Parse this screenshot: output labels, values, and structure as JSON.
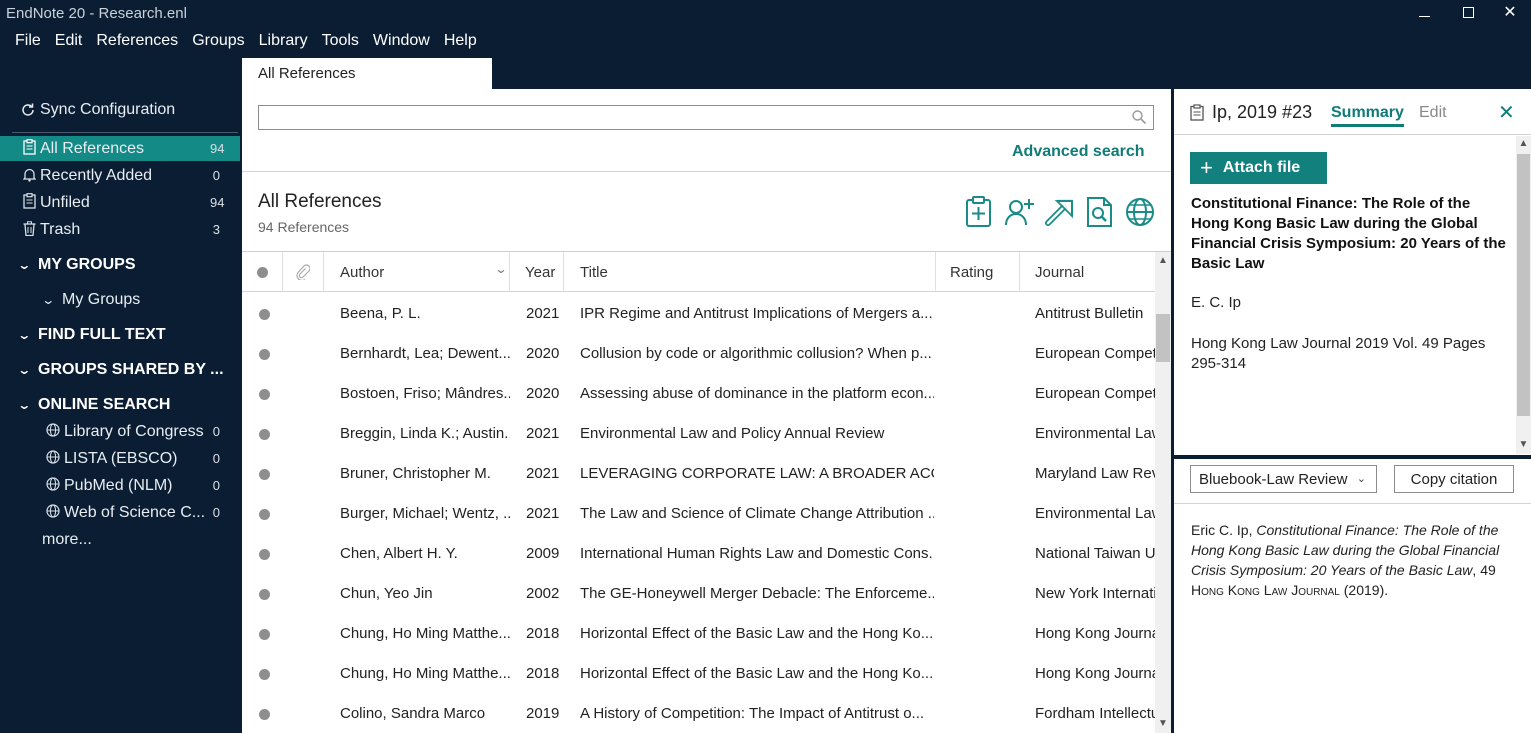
{
  "window": {
    "title": "EndNote 20 - Research.enl",
    "controls": {
      "minimize": "—",
      "close": "✕"
    }
  },
  "menu": [
    "File",
    "Edit",
    "References",
    "Groups",
    "Library",
    "Tools",
    "Window",
    "Help"
  ],
  "sidebar": {
    "sync": "Sync Configuration",
    "items": [
      {
        "label": "All References",
        "count": "94",
        "icon": "clipboard-icon",
        "selected": true
      },
      {
        "label": "Recently Added",
        "count": "0",
        "icon": "bell-icon"
      },
      {
        "label": "Unfiled",
        "count": "94",
        "icon": "clipboard-icon"
      },
      {
        "label": "Trash",
        "count": "3",
        "icon": "trash-icon"
      }
    ],
    "sections": {
      "my_groups": "MY GROUPS",
      "my_groups_sub": "My Groups",
      "find_full_text": "FIND FULL TEXT",
      "groups_shared": "GROUPS SHARED BY ...",
      "online_search": "ONLINE SEARCH"
    },
    "online": [
      {
        "label": "Library of Congress",
        "count": "0"
      },
      {
        "label": "LISTA (EBSCO)",
        "count": "0"
      },
      {
        "label": "PubMed (NLM)",
        "count": "0"
      },
      {
        "label": "Web of Science C...",
        "count": "0"
      }
    ],
    "more": "more..."
  },
  "tab": {
    "label": "All References"
  },
  "search": {
    "value": "",
    "advanced": "Advanced search"
  },
  "library": {
    "title": "All References",
    "count": "94 References"
  },
  "table": {
    "headers": {
      "author": "Author",
      "year": "Year",
      "title": "Title",
      "rating": "Rating",
      "journal": "Journal"
    },
    "rows": [
      {
        "author": "Beena, P. L.",
        "year": "2021",
        "title": "IPR Regime and Antitrust Implications of Mergers a...",
        "journal": "Antitrust Bulletin"
      },
      {
        "author": "Bernhardt, Lea; Dewent...",
        "year": "2020",
        "title": "Collusion by code or algorithmic collusion? When p...",
        "journal": "European Compet"
      },
      {
        "author": "Bostoen, Friso; Mândres...",
        "year": "2020",
        "title": "Assessing abuse of dominance in the platform econ...",
        "journal": "European Compet"
      },
      {
        "author": "Breggin, Linda K.; Austin...",
        "year": "2021",
        "title": "Environmental Law and Policy Annual Review",
        "journal": "Environmental Law"
      },
      {
        "author": "Bruner, Christopher M.",
        "year": "2021",
        "title": "LEVERAGING CORPORATE LAW: A BROADER ACCO...",
        "journal": "Maryland Law Rev"
      },
      {
        "author": "Burger, Michael; Wentz, ...",
        "year": "2021",
        "title": "The Law and Science of Climate Change Attribution ...",
        "journal": "Environmental Law"
      },
      {
        "author": "Chen, Albert H. Y.",
        "year": "2009",
        "title": "International Human Rights Law and Domestic Cons...",
        "journal": "National Taiwan U"
      },
      {
        "author": "Chun, Yeo Jin",
        "year": "2002",
        "title": "The GE-Honeywell Merger Debacle: The Enforceme...",
        "journal": "New York Internati"
      },
      {
        "author": "Chung, Ho Ming Matthe...",
        "year": "2018",
        "title": "Horizontal Effect of the Basic Law and the Hong Ko...",
        "journal": "Hong Kong Journa"
      },
      {
        "author": "Chung, Ho Ming Matthe...",
        "year": "2018",
        "title": "Horizontal Effect of the Basic Law and the Hong Ko...",
        "journal": "Hong Kong Journa"
      },
      {
        "author": "Colino, Sandra Marco",
        "year": "2019",
        "title": "A History of Competition: The Impact of Antitrust o...",
        "journal": "Fordham Intellectu"
      }
    ]
  },
  "panel": {
    "ref": "Ip, 2019 #23",
    "tab_summary": "Summary",
    "tab_edit": "Edit",
    "close": "✕",
    "attach": "Attach file",
    "ref_title": "Constitutional Finance: The Role of the Hong Kong Basic Law during the Global Financial Crisis Symposium: 20 Years of the Basic Law",
    "author": "E. C. Ip",
    "source": "Hong Kong Law Journal 2019 Vol. 49 Pages 295-314",
    "style": "Bluebook-Law Review",
    "copy": "Copy citation",
    "citation": {
      "author": "Eric C. Ip, ",
      "title": "Constitutional Finance: The Role of the Hong Kong Basic Law during the Global Financial Crisis Symposium: 20 Years of the Basic Law",
      "vol": ", 49 ",
      "journal": "Hong Kong Law Journal",
      "year": " (2019)."
    }
  },
  "colors": {
    "navy": "#0b1d33",
    "teal": "#138a86",
    "teal_text": "#0f7c78"
  }
}
